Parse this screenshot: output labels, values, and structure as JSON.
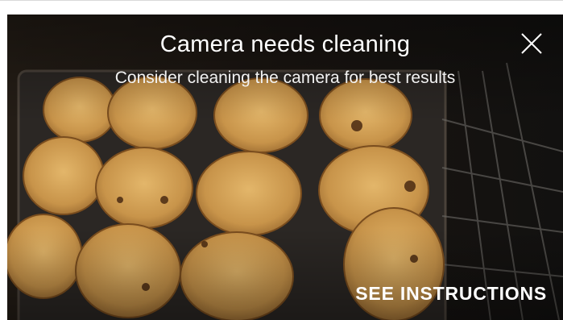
{
  "dialog": {
    "title": "Camera needs cleaning",
    "subtitle": "Consider cleaning the camera for best results",
    "action_label": "SEE INSTRUCTIONS",
    "close_icon": "close-icon"
  },
  "colors": {
    "text": "#ffffff",
    "background": "#0d0c0a"
  }
}
